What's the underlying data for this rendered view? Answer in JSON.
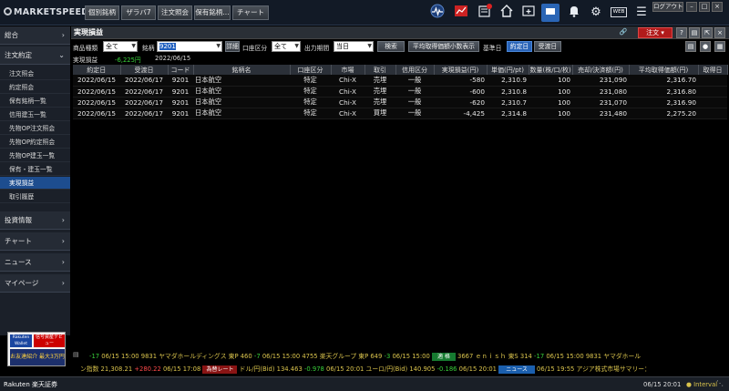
{
  "app": {
    "logo": "MARKETSPEED II"
  },
  "toolbar": {
    "buttons": [
      "個別銘柄",
      "ザラバ7",
      "注文照会",
      "保有銘柄...",
      "チャート"
    ],
    "logout": "ログアウト",
    "web": "WEB"
  },
  "sidebar": {
    "sections": [
      {
        "label": "総合"
      },
      {
        "label": "注文約定"
      },
      {
        "label": "投資情報"
      },
      {
        "label": "チャート"
      },
      {
        "label": "ニュース"
      },
      {
        "label": "マイページ"
      }
    ],
    "subitems": [
      "注文照会",
      "約定照会",
      "保有銘柄一覧",
      "信用建玉一覧",
      "先物OP注文照会",
      "先物OP約定照会",
      "先物OP建玉一覧",
      "保有・建玉一覧",
      "実現損益",
      "取引履歴"
    ],
    "active_subitem": "実現損益"
  },
  "banner": {
    "line1": "Rakuten Wallet",
    "line2": "信号資産デビュー",
    "line3": "お友達紹介 最大3万円"
  },
  "panel": {
    "title": "実現損益",
    "order_button": "注文"
  },
  "filters": {
    "product_label": "商品種類",
    "product_value": "全て",
    "symbol_label": "銘柄",
    "symbol_value": "9201",
    "detail_button": "詳細",
    "account_label": "口座区分",
    "account_value": "全て",
    "period_label": "出力期間",
    "period_value": "当日",
    "search_button": "検索",
    "avg_button": "平均取得価額小数表示",
    "base_label": "基準日",
    "base_trade": "約定日",
    "base_settle": "受渡日"
  },
  "summary": {
    "label": "実現損益",
    "value": "-6,225円",
    "date": "2022/06/15"
  },
  "table": {
    "columns": [
      "約定日",
      "受渡日",
      "コード",
      "銘柄名",
      "口座区分",
      "市場",
      "取引",
      "信用区分",
      "実現損益(円)",
      "単価(円/pt)",
      "数量(株/口/枚)",
      "売却/決済額(円)",
      "平均取得価額(円)",
      "取得日"
    ],
    "rows": [
      [
        "2022/06/15",
        "2022/06/17",
        "9201",
        "日本航空",
        "特定",
        "Chi-X",
        "売埋",
        "一般",
        "-580",
        "2,310.9",
        "100",
        "231,090",
        "2,316.70",
        ""
      ],
      [
        "2022/06/15",
        "2022/06/17",
        "9201",
        "日本航空",
        "特定",
        "Chi-X",
        "売埋",
        "一般",
        "-600",
        "2,310.8",
        "100",
        "231,080",
        "2,316.80",
        ""
      ],
      [
        "2022/06/15",
        "2022/06/17",
        "9201",
        "日本航空",
        "特定",
        "Chi-X",
        "売埋",
        "一般",
        "-620",
        "2,310.7",
        "100",
        "231,070",
        "2,316.90",
        ""
      ],
      [
        "2022/06/15",
        "2022/06/17",
        "9201",
        "日本航空",
        "特定",
        "Chi-X",
        "買埋",
        "一般",
        "-4,425",
        "2,314.8",
        "100",
        "231,480",
        "2,275.20",
        ""
      ]
    ]
  },
  "ticker": {
    "line1": [
      {
        "t": "-17",
        "c": "g"
      },
      {
        "t": " 06/15 15:00   9831 ヤマダホールディングス 東P 460 ",
        "c": "y"
      },
      {
        "t": "-7",
        "c": "g"
      },
      {
        "t": " 06/15 15:00   4755 楽天グループ 東P 649 ",
        "c": "y"
      },
      {
        "t": "-3",
        "c": "g"
      },
      {
        "t": " 06/15 15:00 ",
        "c": "y"
      },
      {
        "t": "適 格",
        "c": "tag"
      },
      {
        "t": "   3667 ｅｎｉｓｈ 東S 314 ",
        "c": "y"
      },
      {
        "t": "-17",
        "c": "g"
      },
      {
        "t": " 06/15 15:00   9831 ヤマダホール",
        "c": "y"
      }
    ],
    "line2": [
      {
        "t": "ン指数 21,308.21 ",
        "c": "y"
      },
      {
        "t": "+280.22",
        "c": "r"
      },
      {
        "t": " 06/15 17:08   ",
        "c": "y"
      },
      {
        "t": "為替レート",
        "c": "tagr"
      },
      {
        "t": "  ドル/円(Bid) 134.463 ",
        "c": "y"
      },
      {
        "t": "-0.978",
        "c": "g"
      },
      {
        "t": " 06/15 20:01   ユーロ/円(Bid) 140.905 ",
        "c": "y"
      },
      {
        "t": "-0.186",
        "c": "g"
      },
      {
        "t": " 06/15 20:01   ",
        "c": "y"
      },
      {
        "t": "ニュース",
        "c": "tagb"
      },
      {
        "t": "   06/15 19:55  アジア株式市場サマリー：",
        "c": "y"
      }
    ]
  },
  "status": {
    "brand": "Rakuten 楽天証券",
    "clock": "06/15 20:01",
    "interval": "Interval"
  }
}
